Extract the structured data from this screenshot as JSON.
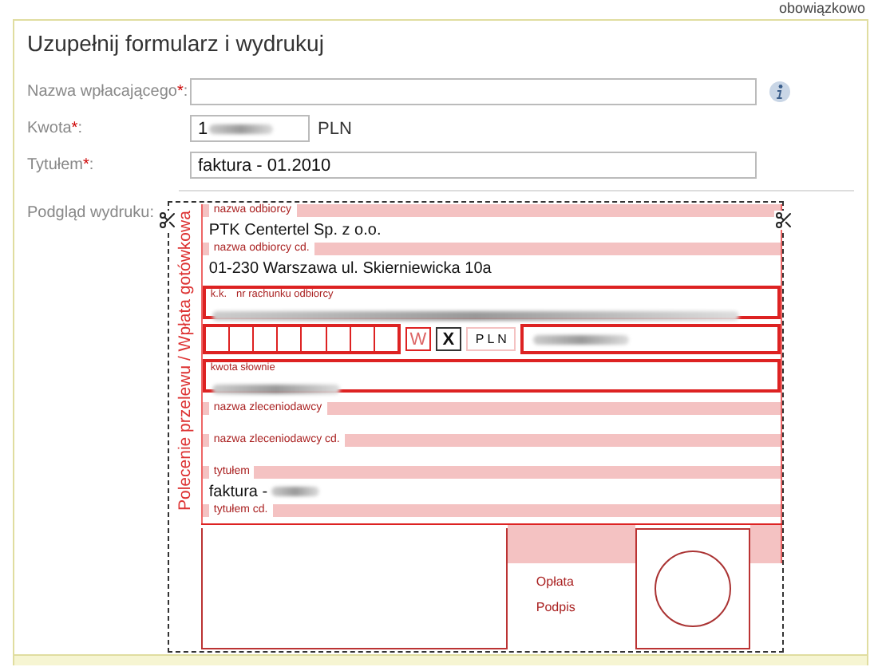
{
  "header_note": "obowiązkowo",
  "title": "Uzupełnij formularz i wydrukuj",
  "fields": [
    {
      "kind": "wide",
      "label": "Nazwa wpłacającego",
      "required_mark": "*",
      "label_end": ":",
      "info": true
    },
    {
      "kind": "short",
      "label": "Kwota",
      "required_mark": "*",
      "label_end": ":",
      "value": "1",
      "blurred": true,
      "unit": "PLN"
    },
    {
      "kind": "wide",
      "label": "Tytułem",
      "required_mark": "*",
      "label_end": ":",
      "value": "faktura - 01.2010"
    }
  ],
  "print_preview": {
    "label": "Podgląd wydruku:",
    "slip": {
      "side_title": "Polecenie przelewu / Wpłata gotówkowa",
      "recipient_label": "nazwa odbiorcy",
      "recipient": "PTK Centertel Sp. z o.o.",
      "recipient_cont_label": "nazwa odbiorcy cd.",
      "recipient_cont": "01-230 Warszawa ul. Skierniewicka 10a",
      "checksum_label": "k.k.",
      "account_label": "nr rachunku odbiorcy",
      "transfer_mark": "W",
      "payment_mark": "X",
      "currency": "P L N",
      "amount_words_label": "kwota słownie",
      "payer_label": "nazwa zleceniodawcy",
      "payer_cont_label": "nazwa zleceniodawcy cd.",
      "title_label": "tytułem",
      "title_value": "faktura - ",
      "title_cont_label": "tytułem cd.",
      "fee_label": "Opłata",
      "signature_label": "Podpis"
    }
  }
}
